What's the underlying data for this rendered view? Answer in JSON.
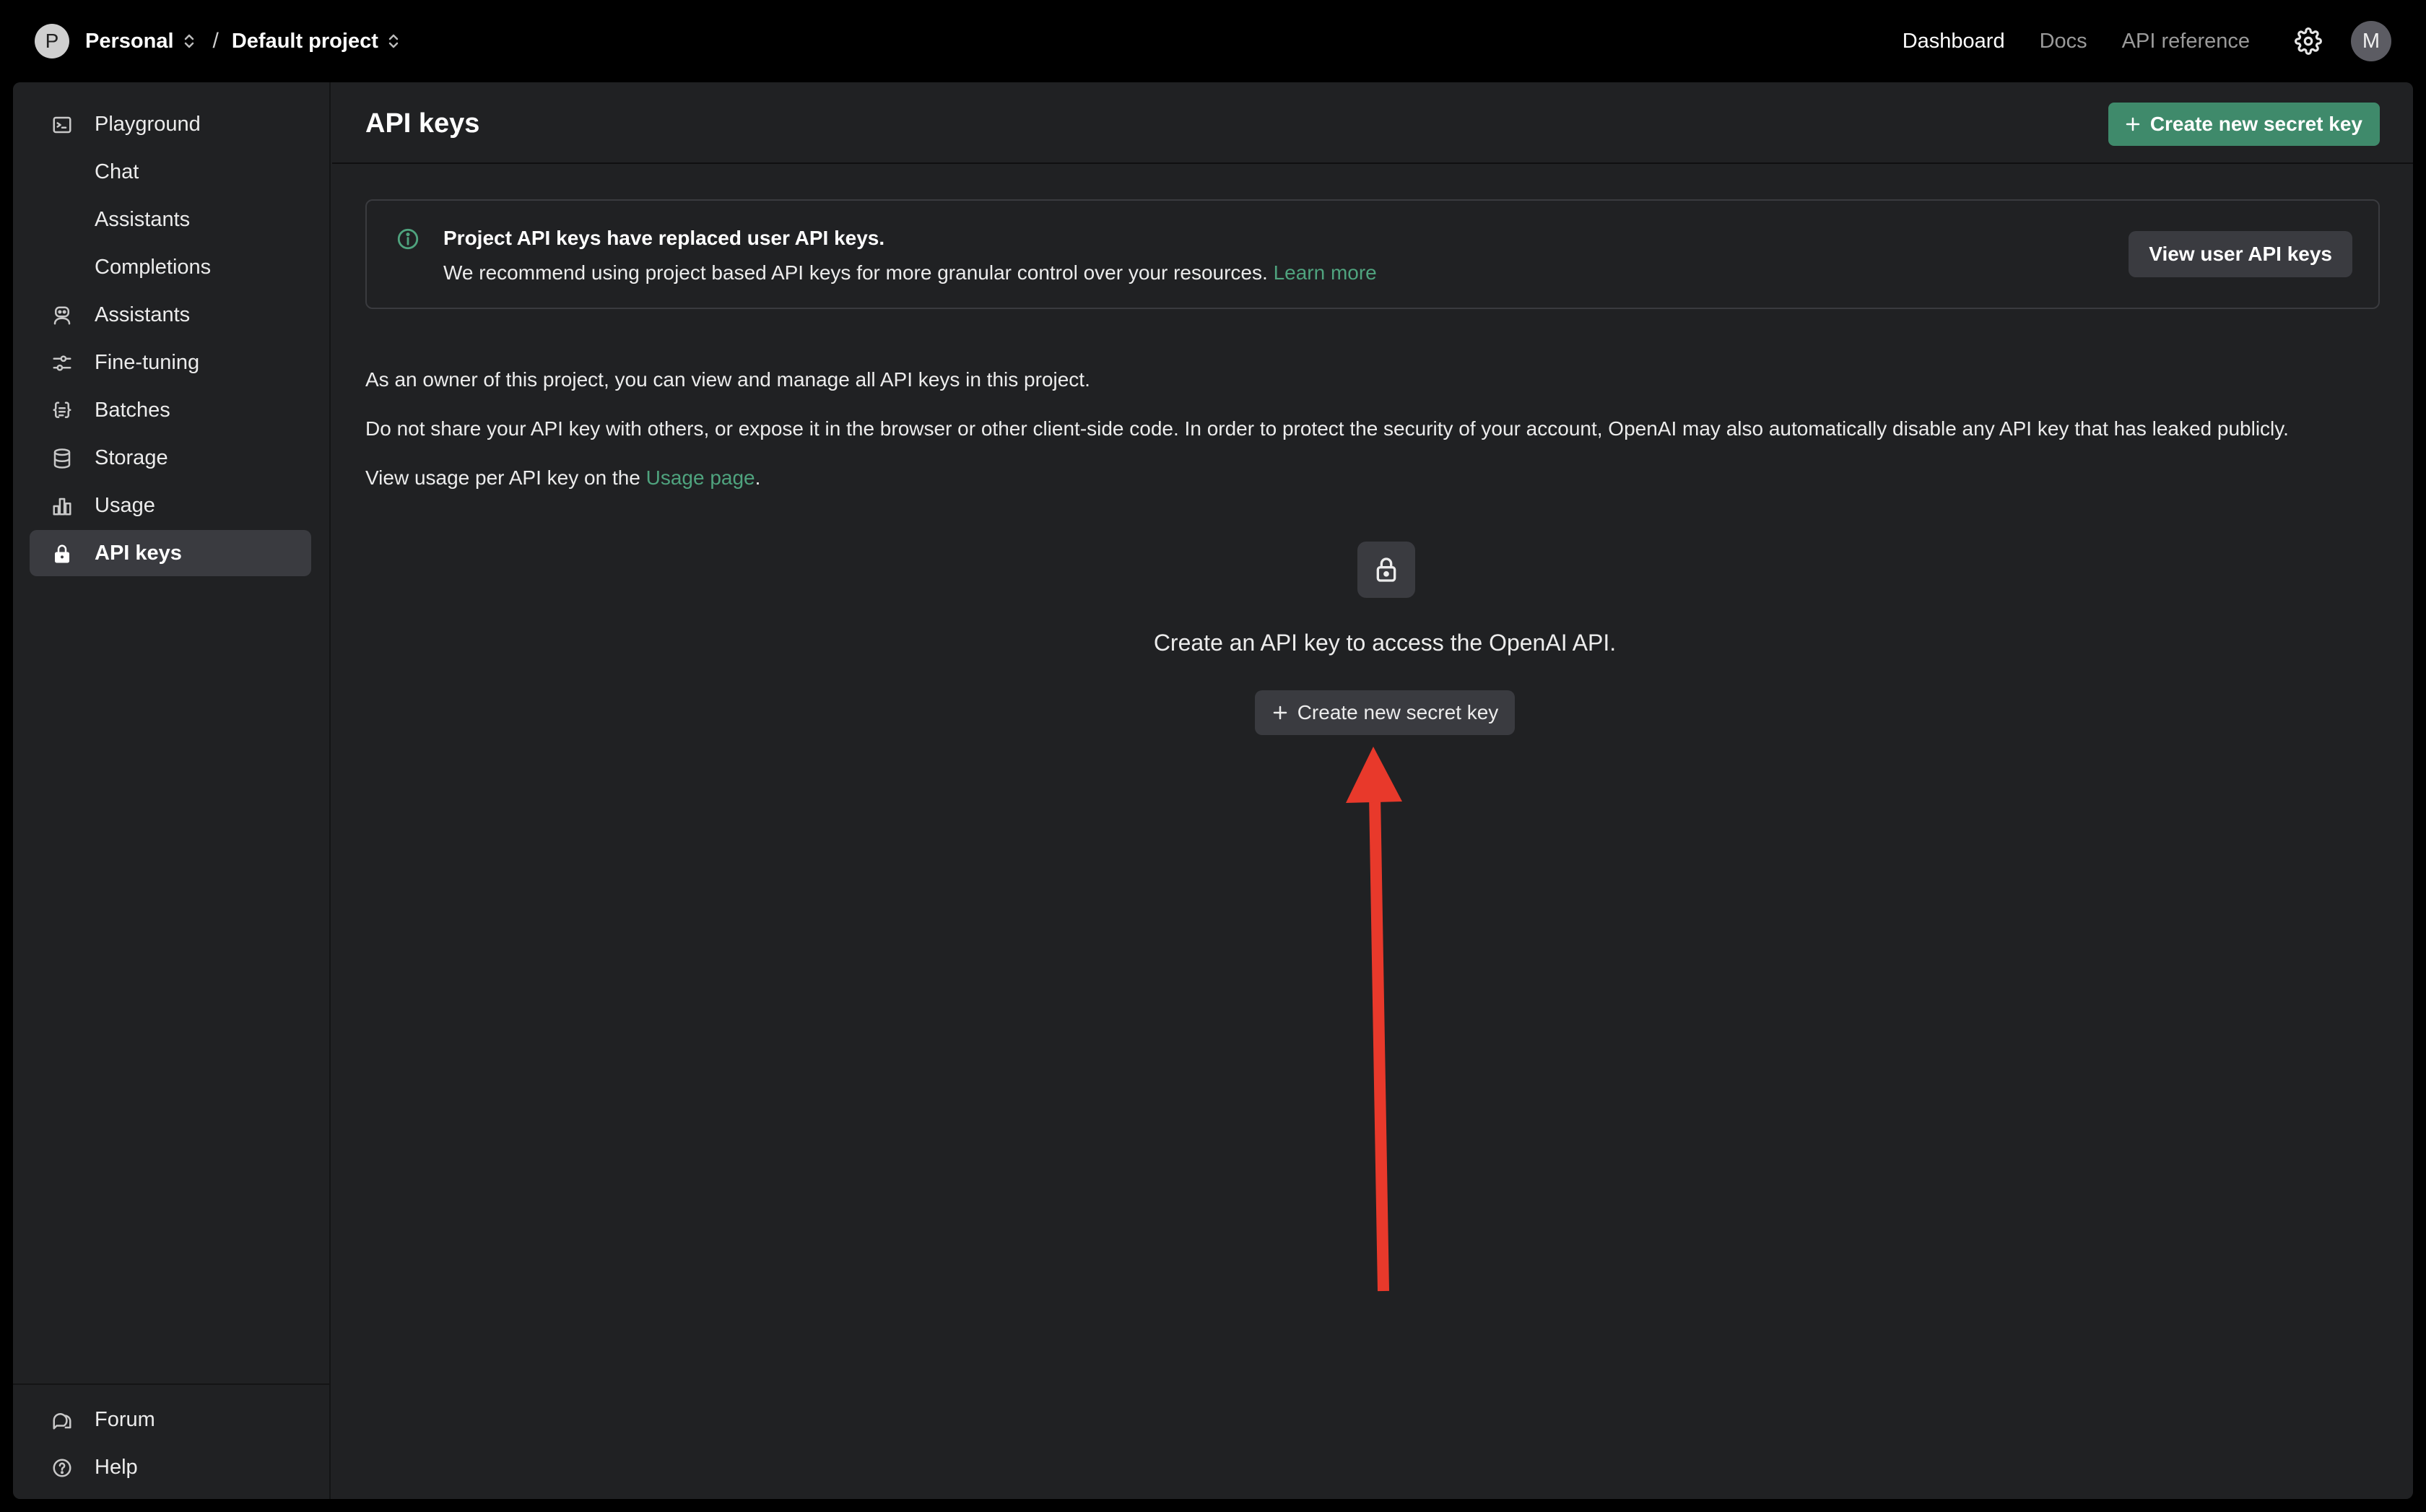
{
  "topbar": {
    "org_initial": "P",
    "org_name": "Personal",
    "separator": "/",
    "project_name": "Default project",
    "nav": {
      "dashboard": "Dashboard",
      "docs": "Docs",
      "api_reference": "API reference"
    },
    "user_initial": "M"
  },
  "sidebar": {
    "items": [
      {
        "label": "Playground",
        "icon": "terminal-icon"
      },
      {
        "label": "Chat"
      },
      {
        "label": "Assistants"
      },
      {
        "label": "Completions"
      },
      {
        "label": "Assistants",
        "icon": "robot-icon"
      },
      {
        "label": "Fine-tuning",
        "icon": "sliders-icon"
      },
      {
        "label": "Batches",
        "icon": "braces-icon"
      },
      {
        "label": "Storage",
        "icon": "database-icon"
      },
      {
        "label": "Usage",
        "icon": "bar-chart-icon"
      },
      {
        "label": "API keys",
        "icon": "lock-icon",
        "active": true
      }
    ],
    "footer": [
      {
        "label": "Forum",
        "icon": "chat-bubbles-icon"
      },
      {
        "label": "Help",
        "icon": "question-circle-icon"
      }
    ]
  },
  "main": {
    "title": "API keys",
    "create_button": "Create new secret key",
    "notice": {
      "title": "Project API keys have replaced user API keys.",
      "body": "We recommend using project based API keys for more granular control over your resources.",
      "link": "Learn more",
      "button": "View user API keys"
    },
    "para1": "As an owner of this project, you can view and manage all API keys in this project.",
    "para2": "Do not share your API key with others, or expose it in the browser or other client-side code. In order to protect the security of your account, OpenAI may also automatically disable any API key that has leaked publicly.",
    "para3_prefix": "View usage per API key on the ",
    "para3_link": "Usage page",
    "para3_suffix": ".",
    "empty_state": {
      "message": "Create an API key to access the OpenAI API.",
      "button": "Create new secret key"
    }
  },
  "colors": {
    "background": "#000000",
    "panel": "#202123",
    "accent_green": "#3f8a6b",
    "link_green": "#4fa37e",
    "annotation_arrow": "#e8392b"
  }
}
